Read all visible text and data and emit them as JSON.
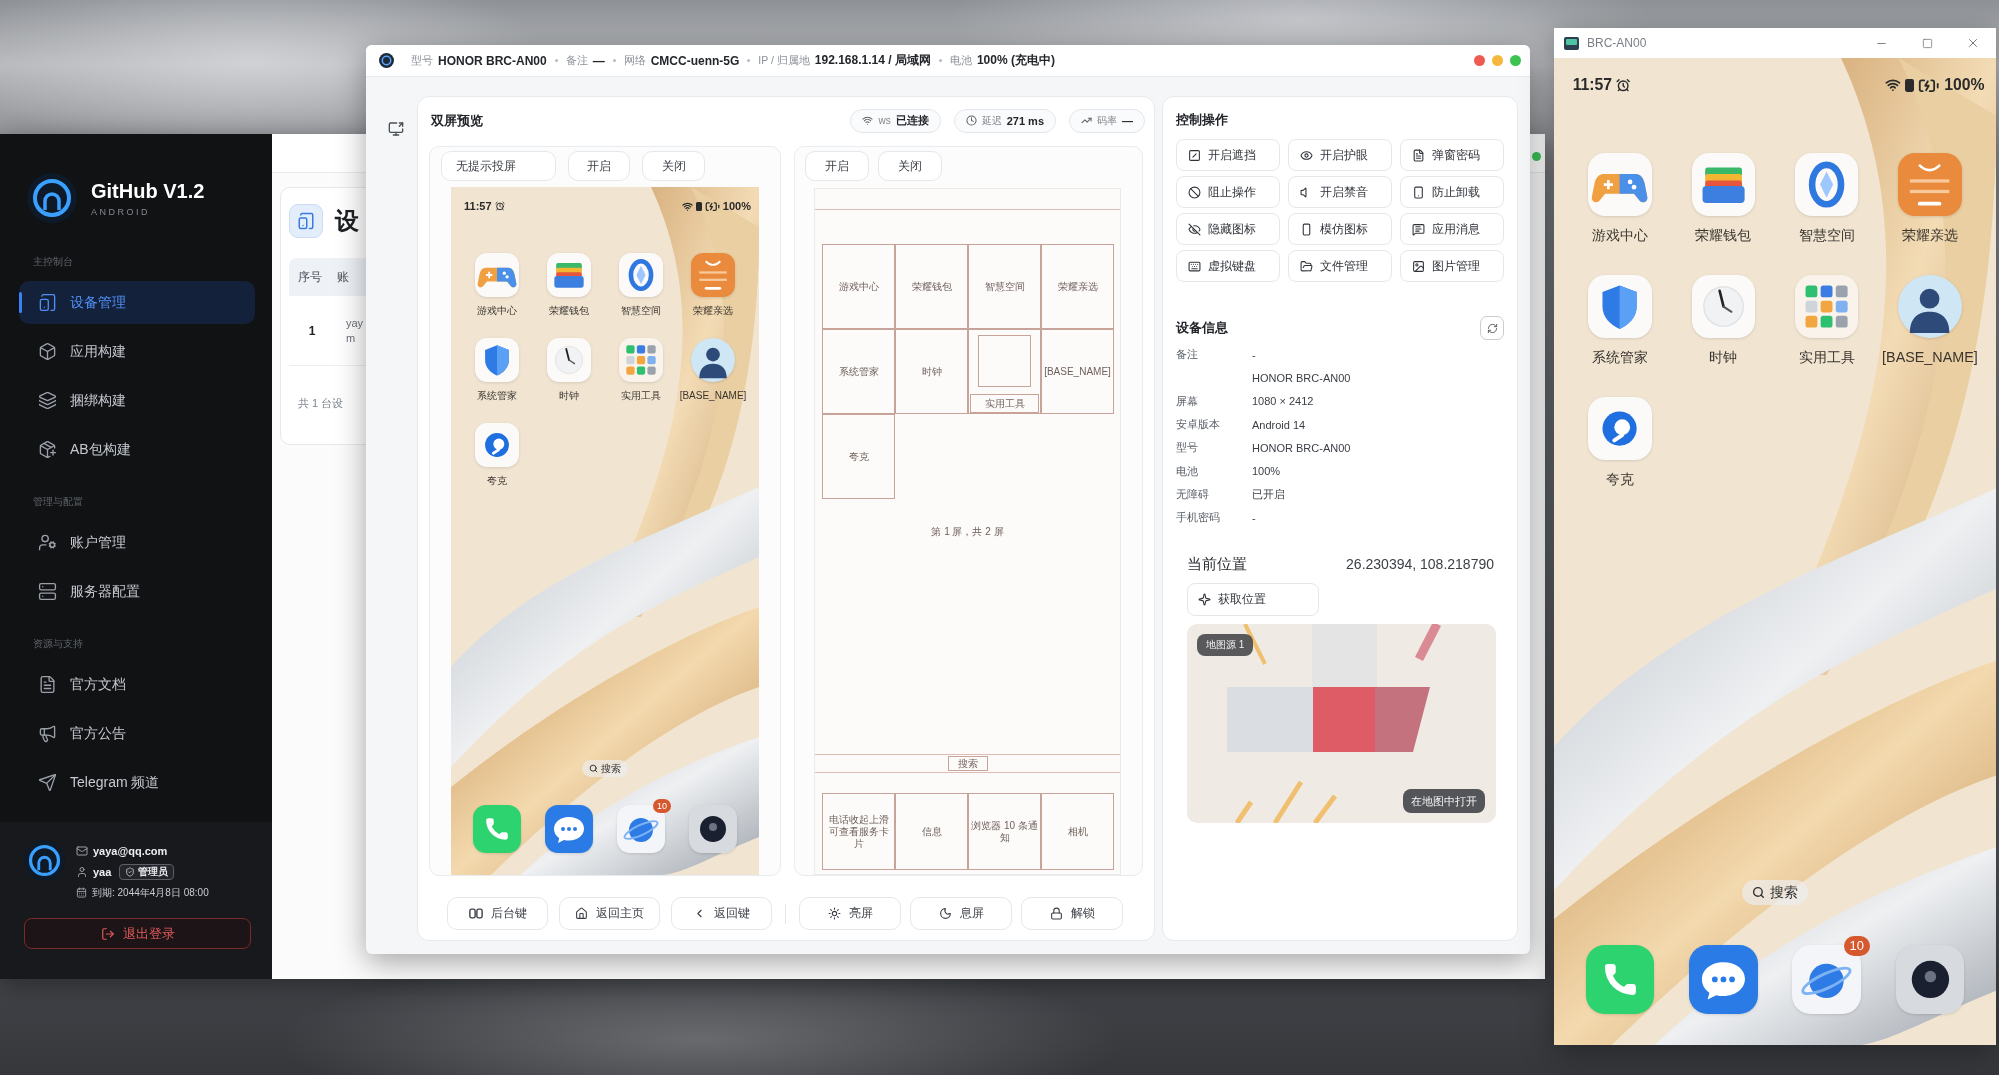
{
  "admin_window": {
    "brand": {
      "title": "GitHub V1.2",
      "subtitle": "ANDROID"
    },
    "nav_sections": [
      {
        "title": "主控制台",
        "items": [
          {
            "label": "设备管理",
            "selected": true
          },
          {
            "label": "应用构建",
            "selected": false
          },
          {
            "label": "捆绑构建",
            "selected": false
          },
          {
            "label": "AB包构建",
            "selected": false
          }
        ]
      },
      {
        "title": "管理与配置",
        "items": [
          {
            "label": "账户管理",
            "selected": false
          },
          {
            "label": "服务器配置",
            "selected": false
          }
        ]
      },
      {
        "title": "资源与支持",
        "items": [
          {
            "label": "官方文档",
            "selected": false
          },
          {
            "label": "官方公告",
            "selected": false
          },
          {
            "label": "Telegram 频道",
            "selected": false
          }
        ]
      }
    ],
    "user": {
      "email": "yaya@qq.com",
      "name": "yaa",
      "role": "管理员",
      "expiry": "到期: 2044年4月8日 08:00"
    },
    "logout_button": "退出登录",
    "page_title": "设",
    "table": {
      "columns": [
        "序号",
        "账"
      ],
      "rows": [
        {
          "index": "1",
          "column_2_lines": [
            "yay",
            "m"
          ]
        }
      ]
    },
    "footer": "共 1 台设"
  },
  "device_window": {
    "title_fields": [
      {
        "label": "型号",
        "value": "HONOR BRC-AN00"
      },
      {
        "label": "备注",
        "value": "—"
      },
      {
        "label": "网络",
        "value": "CMCC-uenn-5G"
      },
      {
        "label": "IP / 归属地",
        "value": "192.168.1.14 / 局域网"
      },
      {
        "label": "电池",
        "value": "100% (充电中)"
      }
    ],
    "preview": {
      "title": "双屏预览",
      "chips": [
        {
          "label": "ws",
          "value": "已连接"
        },
        {
          "label": "延迟",
          "value": "271 ms"
        },
        {
          "label": "码率",
          "value": "—"
        }
      ],
      "mirror": {
        "buttons": [
          "无提示投屏",
          "开启",
          "关闭"
        ],
        "screen": {
          "time": "11:57",
          "battery": "100%",
          "apps": [
            {
              "label": "游戏中心"
            },
            {
              "label": "荣耀钱包"
            },
            {
              "label": "智慧空间"
            },
            {
              "label": "荣耀亲选"
            },
            {
              "label": "系统管家"
            },
            {
              "label": "时钟"
            },
            {
              "label": "实用工具"
            },
            {
              "label": "[BASE_NAME]"
            },
            {
              "label": "夸克"
            }
          ],
          "search": "搜索",
          "dock": [
            {
              "has_badge": false
            },
            {
              "has_badge": false
            },
            {
              "has_badge": true,
              "badge": "10"
            },
            {
              "has_badge": false
            }
          ]
        }
      },
      "inspector": {
        "buttons": [
          "开启",
          "关闭"
        ],
        "nodes": [
          {
            "kind": "app",
            "label": "游戏中心"
          },
          {
            "kind": "app",
            "label": "荣耀钱包"
          },
          {
            "kind": "app",
            "label": "智慧空间"
          },
          {
            "kind": "app",
            "label": "荣耀亲选"
          },
          {
            "kind": "app",
            "label": "系统管家"
          },
          {
            "kind": "app",
            "label": "时钟"
          },
          {
            "kind": "folder",
            "label": "实用工具"
          },
          {
            "kind": "app",
            "label": "[BASE_NAME]"
          },
          {
            "kind": "app",
            "label": "夸克"
          }
        ],
        "page_label": "第 1 屏，共 2 屏",
        "search_label": "搜索",
        "dock_nodes": [
          "电话收起上滑可查看服务卡片",
          "信息",
          "浏览器 10 条通知",
          "相机"
        ]
      },
      "key_buttons": [
        "后台键",
        "返回主页",
        "返回键"
      ],
      "screen_buttons": [
        "亮屏",
        "息屏",
        "解锁"
      ]
    },
    "controls": {
      "title": "控制操作",
      "buttons": [
        "开启遮挡",
        "开启护眼",
        "弹窗密码",
        "阻止操作",
        "开启禁音",
        "防止卸载",
        "隐藏图标",
        "模仿图标",
        "应用消息",
        "虚拟键盘",
        "文件管理",
        "图片管理"
      ]
    },
    "device_info": {
      "title": "设备信息",
      "rows": [
        {
          "label": "备注",
          "value": "-"
        },
        {
          "value": "HONOR BRC-AN00"
        },
        {
          "label": "屏幕",
          "value": "1080 × 2412"
        },
        {
          "label": "安卓版本",
          "value": "Android 14"
        },
        {
          "label": "型号",
          "value": "HONOR BRC-AN00"
        },
        {
          "label": "电池",
          "value": "100%"
        },
        {
          "label": "无障碍",
          "value": "已开启"
        },
        {
          "label": "手机密码",
          "value": "-"
        }
      ]
    },
    "location": {
      "title": "当前位置",
      "coordinates": "26.230394, 108.218790",
      "locate_button": "获取位置",
      "map_source": "地图源 1",
      "open_map_button": "在地图中打开"
    }
  },
  "phone_window": {
    "title": "BRC-AN00",
    "screen": {
      "time": "11:57",
      "battery": "100%",
      "apps": [
        {
          "label": "游戏中心"
        },
        {
          "label": "荣耀钱包"
        },
        {
          "label": "智慧空间"
        },
        {
          "label": "荣耀亲选"
        },
        {
          "label": "系统管家"
        },
        {
          "label": "时钟"
        },
        {
          "label": "实用工具"
        },
        {
          "label": "[BASE_NAME]"
        },
        {
          "label": "夸克"
        }
      ],
      "search": "搜索",
      "dock": [
        {
          "has_badge": false
        },
        {
          "has_badge": false
        },
        {
          "has_badge": true,
          "badge": "10"
        },
        {
          "has_badge": false
        }
      ]
    }
  }
}
